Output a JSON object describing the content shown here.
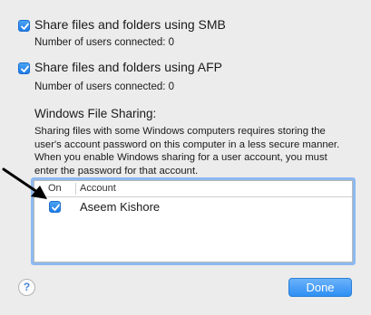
{
  "smb": {
    "checkbox_label": "Share files and folders using SMB",
    "checked": true,
    "status": "Number of users connected: 0"
  },
  "afp": {
    "checkbox_label": "Share files and folders using AFP",
    "checked": true,
    "status": "Number of users connected: 0"
  },
  "windows": {
    "title": "Windows File Sharing:",
    "description": "Sharing files with some Windows computers requires storing the user's account password on this computer in a less secure manner.  When you enable Windows sharing for a user account, you must enter the password for that account.",
    "columns": {
      "on": "On",
      "account": "Account"
    },
    "accounts": [
      {
        "name": "Aseem Kishore",
        "on": true
      }
    ]
  },
  "footer": {
    "help": "?",
    "done_label": "Done"
  },
  "colors": {
    "accent": "#1d7be6",
    "arrow": "#000000"
  }
}
